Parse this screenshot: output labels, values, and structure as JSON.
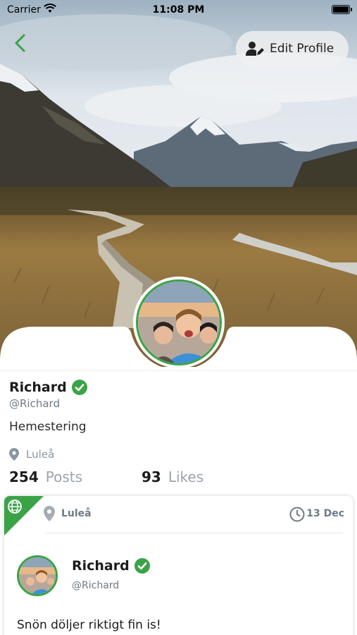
{
  "status_bar": {
    "carrier": "Carrier",
    "time": "11:08 PM"
  },
  "header": {
    "back_icon": "chevron-left-icon",
    "edit_profile_label": "Edit Profile",
    "edit_icon": "user-edit-icon"
  },
  "profile": {
    "name": "Richard",
    "handle": "@Richard",
    "bio": "Hemestering",
    "location": "Luleå",
    "verified": true,
    "stats": [
      {
        "value": "254",
        "label": "Posts"
      },
      {
        "value": "93",
        "label": "Likes"
      }
    ]
  },
  "post": {
    "location": "Luleå",
    "date": "13 Dec",
    "author_name": "Richard",
    "author_handle": "@Richard",
    "text": "Snön döljer riktigt fin is!",
    "visibility_icon": "globe-icon"
  },
  "colors": {
    "accent": "#3aa346",
    "muted": "#6e7a86",
    "stat_label": "#9aa4ad"
  }
}
